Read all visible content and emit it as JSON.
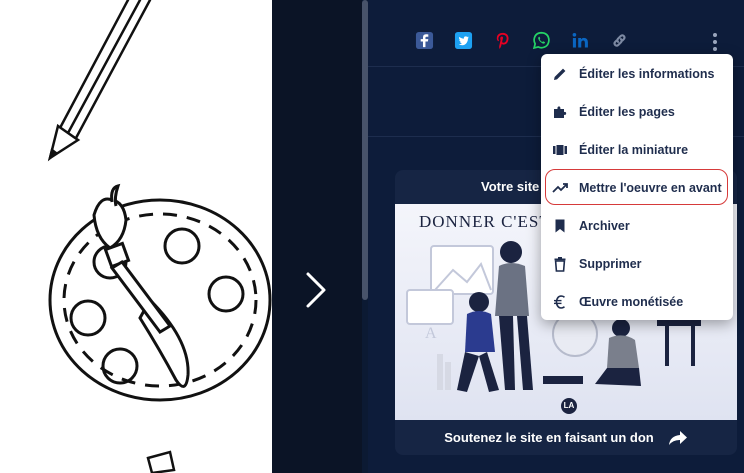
{
  "artwork": {
    "icons": [
      "pencil-icon",
      "paint-palette-icon",
      "paintbrush-icon"
    ]
  },
  "gallery": {
    "next_icon": "chevron-right-icon"
  },
  "share_bar": {
    "items": [
      {
        "icon": "facebook-icon",
        "color": "#3b5998"
      },
      {
        "icon": "twitter-icon",
        "color": "#1da1f2"
      },
      {
        "icon": "pinterest-icon",
        "color": "#e60023"
      },
      {
        "icon": "whatsapp-icon",
        "color": "#25d366"
      },
      {
        "icon": "linkedin-icon",
        "color": "#0a66c2"
      },
      {
        "icon": "link-icon",
        "color": "#7d8aa3"
      }
    ]
  },
  "menu": {
    "items": [
      {
        "label": "Éditer les informations",
        "icon": "pencil-icon"
      },
      {
        "label": "Éditer les pages",
        "icon": "puzzle-icon"
      },
      {
        "label": "Éditer la miniature",
        "icon": "film-icon"
      },
      {
        "label": "Mettre l'oeuvre en avant",
        "icon": "trending-up-icon"
      },
      {
        "label": "Archiver",
        "icon": "bookmark-icon"
      },
      {
        "label": "Supprimer",
        "icon": "trash-icon"
      },
      {
        "label": "Œuvre monétisée",
        "icon": "euro-icon"
      }
    ],
    "highlight_color": "#d63a3a"
  },
  "donate": {
    "title": "Votre site",
    "illustration_heading": "DONNER C'EST",
    "badge": "LA",
    "footer_label": "Soutenez le site en faisant un don",
    "footer_icon": "share-arrow-icon"
  },
  "colors": {
    "background": "#0c1a33",
    "menu_text": "#1f2d4d",
    "accent_highlight": "#d63a3a"
  }
}
